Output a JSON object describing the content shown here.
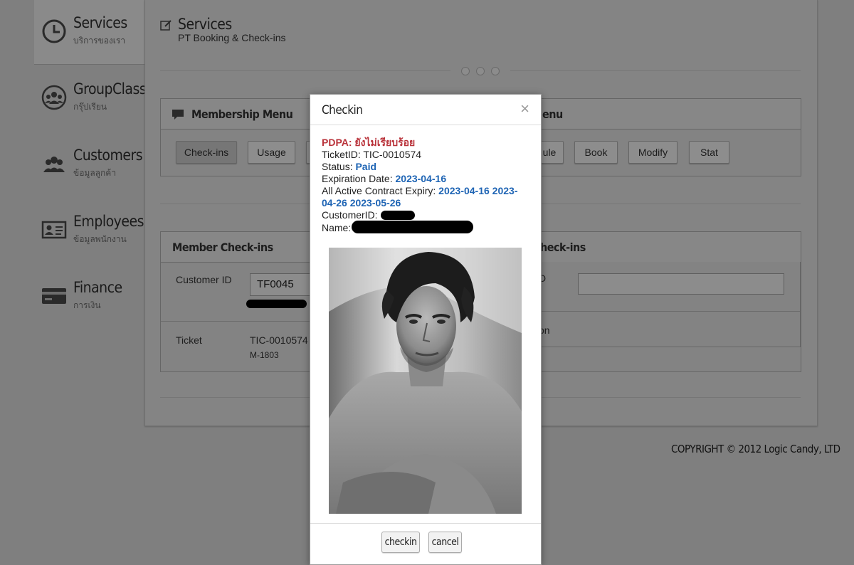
{
  "sidebar": {
    "items": [
      {
        "title": "Services",
        "subtitle": "บริการของเรา"
      },
      {
        "title": "GroupClass",
        "subtitle": "กรุ๊ปเรียน"
      },
      {
        "title": "Customers",
        "subtitle": "ข้อมูลลูกค้า"
      },
      {
        "title": "Employees",
        "subtitle": "ข้อมูลพนักงาน"
      },
      {
        "title": "Finance",
        "subtitle": "การเงิน"
      }
    ]
  },
  "header": {
    "title": "Services",
    "subtitle": "PT Booking & Check-ins"
  },
  "membership_menu": {
    "title": "Membership Menu",
    "buttons": [
      "Check-ins",
      "Usage"
    ]
  },
  "right_menu": {
    "title_fragment": "enu",
    "buttons": [
      "ule",
      "Book",
      "Modify",
      "Stat"
    ]
  },
  "member_checkins": {
    "title": "Member Check-ins",
    "customer_id_label": "Customer ID",
    "customer_id_value": "TF0045",
    "ticket_label": "Ticket",
    "ticket_value": "TIC-0010574",
    "ticket_sub": "M-1803"
  },
  "right_checkins": {
    "title_fragment": "heck-ins",
    "row1_fragment": "D",
    "row2_fragment": "on"
  },
  "footer": {
    "copyright": "COPYRIGHT © 2012 Logic Candy, LTD"
  },
  "modal": {
    "title": "Checkin",
    "close": "×",
    "pdpa": "PDPA: ยังไม่เรียบร้อย",
    "ticket_line": "TicketID: TIC-0010574",
    "status_label": "Status: ",
    "status_value": "Paid",
    "expiration_label": "Expiration Date: ",
    "expiration_value": "2023-04-16",
    "contract_label": "All Active Contract Expiry: ",
    "contract_value_1": "2023-04-16 2023-",
    "contract_value_2": "04-26 2023-05-26",
    "customerid_label": "CustomerID:",
    "name_label": "Name:",
    "checkin_button": "checkin",
    "cancel_button": "cancel"
  }
}
